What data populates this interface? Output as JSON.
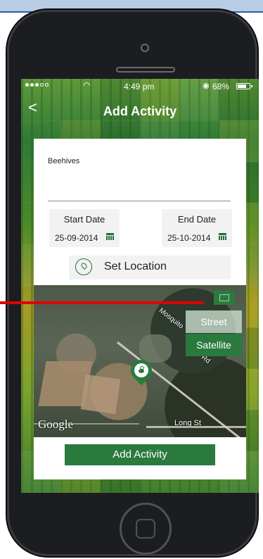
{
  "status": {
    "time": "4:49 pm",
    "battery": "68%"
  },
  "nav": {
    "title": "Add Activity",
    "back_label": "<"
  },
  "form": {
    "name_value": "Beehives",
    "start_date_label": "Start Date",
    "start_date_value": "25-09-2014",
    "end_date_label": "End Date",
    "end_date_value": "25-10-2014",
    "set_location_label": "Set Location"
  },
  "map": {
    "street_label": "Street",
    "satellite_label": "Satellite",
    "selected_type": "Satellite",
    "road_mosquito": "Mosquito",
    "road_rd": "Rd",
    "road_long": "Long St",
    "attribution": "Google"
  },
  "actions": {
    "add_activity_label": "Add Activity"
  },
  "colors": {
    "accent": "#2a7a3e",
    "annotation": "#e00000"
  },
  "icons": [
    "wifi-icon",
    "alarm-icon",
    "battery-icon",
    "back-icon",
    "calendar-icon",
    "location-icon",
    "layers-icon",
    "bee-pin-icon"
  ]
}
